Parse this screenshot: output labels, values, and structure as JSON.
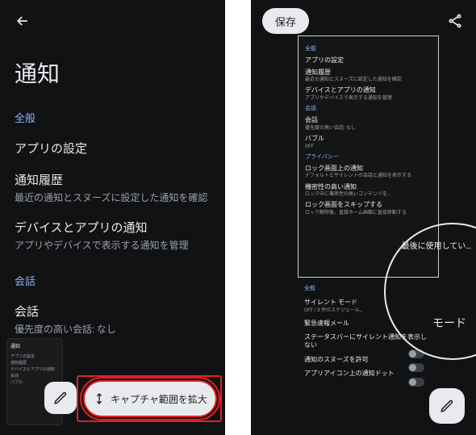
{
  "left": {
    "page_title": "通知",
    "sections": [
      {
        "header": "全般",
        "rows": [
          {
            "title": "アプリの設定",
            "sub": ""
          },
          {
            "title": "通知履歴",
            "sub": "最近の通知とスヌーズに設定した通知を確認"
          },
          {
            "title": "デバイスとアプリの通知",
            "sub": "アプリやデバイスで表示する通知を管理"
          }
        ]
      },
      {
        "header": "会話",
        "rows": [
          {
            "title": "会話",
            "sub": "優先度の高い会話: なし"
          }
        ]
      }
    ],
    "thumb": {
      "title": "通知",
      "lines": [
        "アプリの設定",
        "通知履歴",
        "デバイスとアプリの通知",
        "会話",
        "バブル"
      ]
    },
    "extend_label": "キャプチャ範囲を拡大"
  },
  "right": {
    "save_label": "保存",
    "expanded_sections": [
      {
        "header": "全般",
        "rows": [
          {
            "title": "アプリの設定",
            "sub": ""
          },
          {
            "title": "通知履歴",
            "sub": "最近の通知とスヌーズに設定した通知を確認"
          },
          {
            "title": "デバイスとアプリの通知",
            "sub": "アプリやデバイスで表示する通知を管理"
          }
        ]
      },
      {
        "header": "会話",
        "rows": [
          {
            "title": "会話",
            "sub": "優先度の高い会話: なし"
          },
          {
            "title": "バブル",
            "sub": "OFF"
          }
        ]
      },
      {
        "header": "プライバシー",
        "rows": [
          {
            "title": "ロック画面上の通知",
            "sub": "デフォルトとサイレントの会話と通知を表示する"
          },
          {
            "title": "機密性の高い通知",
            "sub": "ロック中に機密性の高いコンテンツを…"
          },
          {
            "title": "ロック画面をスキップする",
            "sub": "ロック解除後、直接ホーム画面に直接移動する"
          }
        ]
      }
    ],
    "below_sections": [
      {
        "header": "全般",
        "rows": [
          {
            "title": "サイレント モード",
            "sub": "OFF / 3 件のスケジュール…",
            "toggle": false
          },
          {
            "title": "緊急速報メール",
            "sub": "",
            "toggle": false
          },
          {
            "title": "ステータスバーにサイレント通知を表示しない",
            "sub": "",
            "toggle": true
          },
          {
            "title": "通知のスヌーズを許可",
            "sub": "",
            "toggle": true
          },
          {
            "title": "アプリアイコン上の通知ドット",
            "sub": "",
            "toggle": true
          }
        ]
      }
    ],
    "mode_hint": "最後に使用してい…",
    "mode_label": "モード"
  }
}
